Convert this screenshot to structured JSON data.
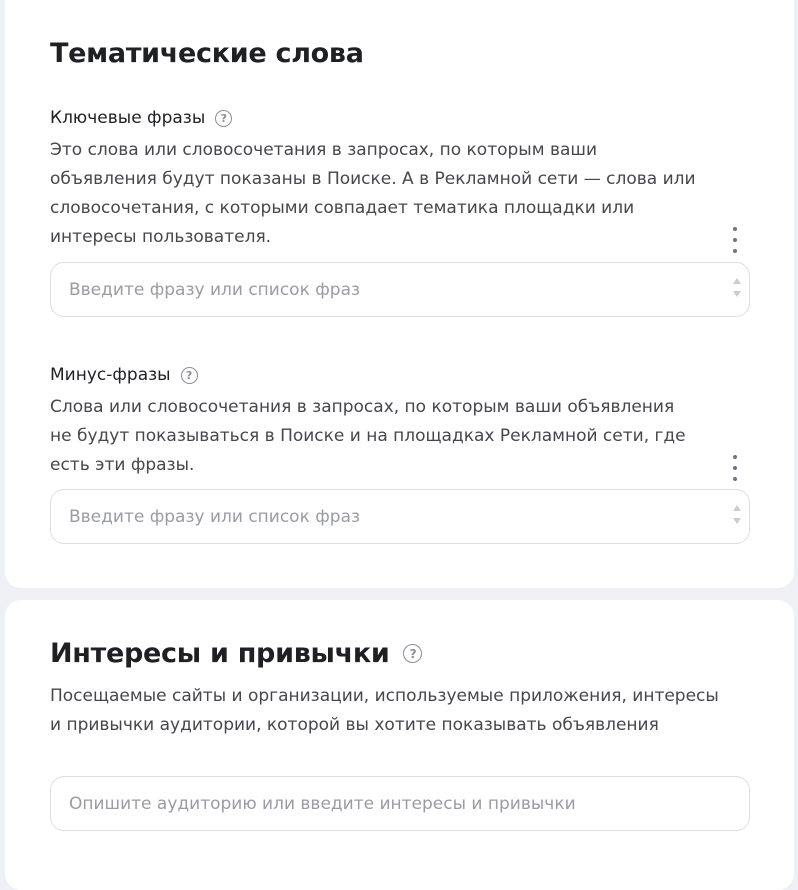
{
  "keywords_section": {
    "title": "Тематические слова",
    "key_phrases": {
      "label": "Ключевые фразы",
      "description_lines": [
        "Это слова или словосочетания в запросах, по которым ваши",
        "объявления будут показаны в Поиске. А в Рекламной сети — слова или",
        "словосочетания, с которыми совпадает тематика площадки или",
        "интересы пользователя."
      ],
      "placeholder": "Введите фразу или список фраз"
    },
    "minus_phrases": {
      "label": "Минус-фразы",
      "description_lines": [
        "Слова или словосочетания в запросах, по которым ваши объявления",
        "не будут показываться в Поиске и на площадках Рекламной сети, где",
        "есть эти фразы."
      ],
      "placeholder": "Введите фразу или список фраз"
    }
  },
  "interests_section": {
    "title": "Интересы и привычки",
    "description_lines": [
      "Посещаемые сайты и организации, используемые приложения, интересы",
      "и привычки аудитории, которой вы хотите показывать объявления"
    ],
    "placeholder": "Опишите аудиторию или введите интересы и привычки"
  },
  "icons": {
    "help": "question-circle-icon",
    "more": "kebab-menu-icon",
    "stepper": "up-down-arrows-icon"
  },
  "colors": {
    "background": "#eef0f5",
    "card": "#ffffff",
    "text_primary": "#1f2024",
    "text_secondary": "#45474d",
    "placeholder": "#9a9ca5",
    "border": "#dcdee3"
  }
}
